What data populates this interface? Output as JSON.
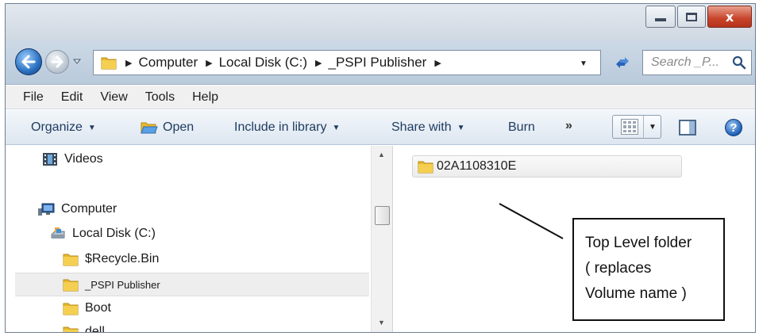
{
  "window": {
    "caption_buttons": {
      "minimize_icon": "minimize-icon",
      "maximize_icon": "maximize-icon",
      "close_glyph": "x"
    }
  },
  "navigation": {
    "back_icon": "back-arrow-icon",
    "forward_icon": "forward-arrow-icon",
    "breadcrumb": [
      "Computer",
      "Local Disk (C:)",
      "_PSPI Publisher"
    ],
    "search_placeholder": "Search _P...",
    "refresh_icon": "refresh-icon"
  },
  "menu": [
    "File",
    "Edit",
    "View",
    "Tools",
    "Help"
  ],
  "commands": {
    "organize": "Organize",
    "open": "Open",
    "include_in_library": "Include in library",
    "share_with": "Share with",
    "burn": "Burn",
    "more": "»"
  },
  "nav_pane": {
    "videos": "Videos",
    "computer": "Computer",
    "local_disk": "Local Disk (C:)",
    "recycle_bin": "$Recycle.Bin",
    "pspi_publisher": "_PSPI Publisher",
    "boot": "Boot",
    "dell": "dell"
  },
  "content": {
    "folder_name": "02A1108310E"
  },
  "annotation": {
    "line1": "Top Level folder",
    "line2": "( replaces",
    "line3": "Volume name )"
  },
  "colors": {
    "folder": "#e8b92f",
    "close_button": "#c8442a",
    "command_text": "#1e3a5f"
  }
}
